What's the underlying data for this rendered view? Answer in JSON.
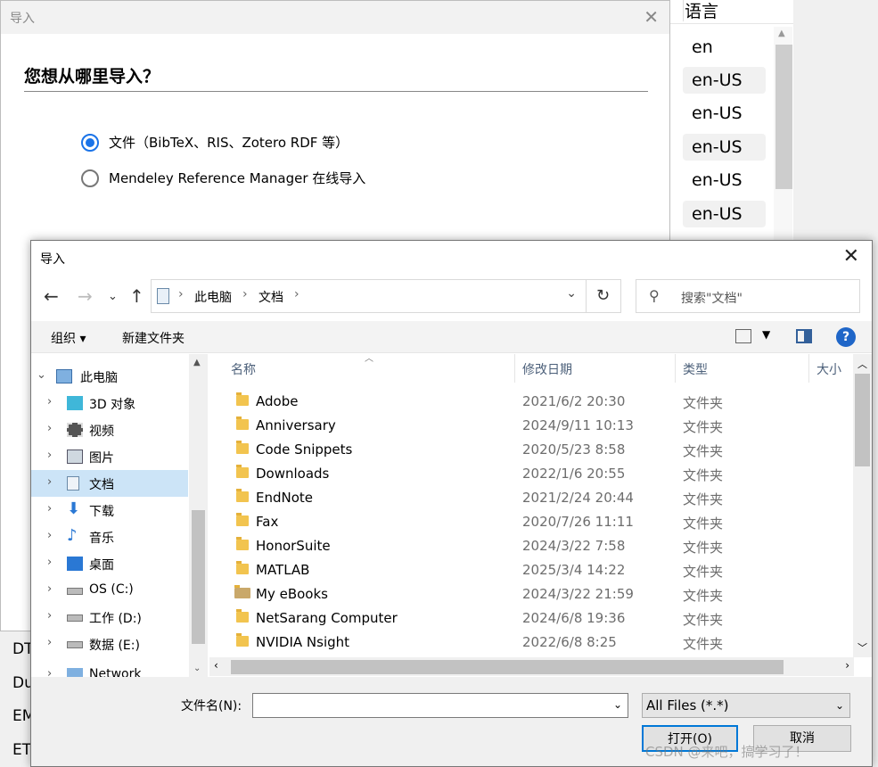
{
  "background": {
    "table_header": "语言",
    "languages": [
      "en",
      "en-US",
      "en-US",
      "en-US",
      "en-US",
      "en-US"
    ],
    "left_rows": [
      "DT",
      "Du",
      "EM",
      "ET"
    ]
  },
  "wizard": {
    "title": "导入",
    "question": "您想从哪里导入？",
    "options": [
      {
        "label": "文件（BibTeX、RIS、Zotero RDF 等）",
        "selected": true
      },
      {
        "label": "Mendeley Reference Manager 在线导入",
        "selected": false
      }
    ]
  },
  "file_dialog": {
    "title": "导入",
    "breadcrumb": [
      "此电脑",
      "文档"
    ],
    "search_placeholder": "搜索\"文档\"",
    "toolbar": {
      "organize": "组织 ▾",
      "new_folder": "新建文件夹"
    },
    "nav": [
      {
        "label": "此电脑",
        "icon": "computer-icon",
        "expanded": true
      },
      {
        "label": "3D 对象",
        "icon": "cube-icon"
      },
      {
        "label": "视频",
        "icon": "video-icon"
      },
      {
        "label": "图片",
        "icon": "picture-icon"
      },
      {
        "label": "文档",
        "icon": "document-icon",
        "selected": true
      },
      {
        "label": "下载",
        "icon": "download-icon"
      },
      {
        "label": "音乐",
        "icon": "music-icon"
      },
      {
        "label": "桌面",
        "icon": "desktop-icon"
      },
      {
        "label": "OS (C:)",
        "icon": "drive-icon"
      },
      {
        "label": "工作 (D:)",
        "icon": "drive-icon"
      },
      {
        "label": "数据 (E:)",
        "icon": "drive-icon"
      },
      {
        "label": "Network",
        "icon": "network-icon"
      }
    ],
    "columns": {
      "name": "名称",
      "date": "修改日期",
      "type": "类型",
      "size": "大小"
    },
    "files": [
      {
        "name": "Adobe",
        "date": "2021/6/2 20:30",
        "type": "文件夹"
      },
      {
        "name": "Anniversary",
        "date": "2024/9/11 10:13",
        "type": "文件夹"
      },
      {
        "name": "Code Snippets",
        "date": "2020/5/23 8:58",
        "type": "文件夹"
      },
      {
        "name": "Downloads",
        "date": "2022/1/6 20:55",
        "type": "文件夹"
      },
      {
        "name": "EndNote",
        "date": "2021/2/24 20:44",
        "type": "文件夹"
      },
      {
        "name": "Fax",
        "date": "2020/7/26 11:11",
        "type": "文件夹"
      },
      {
        "name": "HonorSuite",
        "date": "2024/3/22 7:58",
        "type": "文件夹"
      },
      {
        "name": "MATLAB",
        "date": "2025/3/4 14:22",
        "type": "文件夹"
      },
      {
        "name": "My eBooks",
        "date": "2024/3/22 21:59",
        "type": "文件夹"
      },
      {
        "name": "NetSarang Computer",
        "date": "2024/6/8 19:36",
        "type": "文件夹"
      },
      {
        "name": "NVIDIA Nsight",
        "date": "2022/6/8 8:25",
        "type": "文件夹"
      }
    ],
    "filename_label": "文件名(N):",
    "filename_value": "",
    "filter": "All Files (*.*)",
    "open_button": "打开(O)",
    "cancel_button": "取消"
  },
  "watermark": "CSDN @来吧，搞学习了！"
}
